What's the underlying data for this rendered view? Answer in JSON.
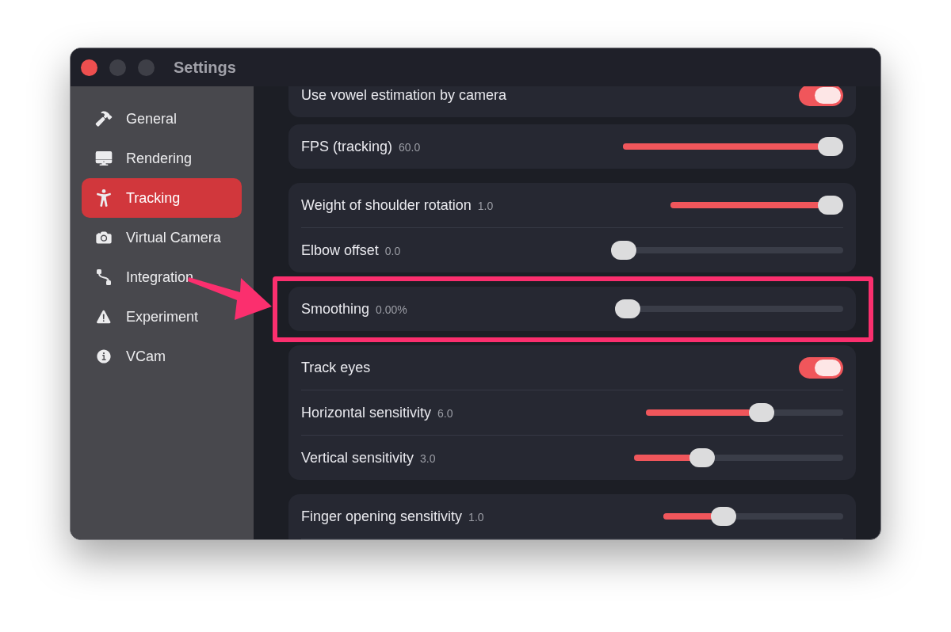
{
  "window": {
    "title": "Settings"
  },
  "sidebar": {
    "items": [
      {
        "label": "General",
        "selected": false
      },
      {
        "label": "Rendering",
        "selected": false
      },
      {
        "label": "Tracking",
        "selected": true
      },
      {
        "label": "Virtual Camera",
        "selected": false
      },
      {
        "label": "Integration",
        "selected": false
      },
      {
        "label": "Experiment",
        "selected": false
      },
      {
        "label": "VCam",
        "selected": false
      }
    ]
  },
  "settings": {
    "groups": [
      {
        "highlighted": false,
        "rows": [
          {
            "kind": "toggle",
            "label": "Use vowel estimation by camera",
            "on": true
          }
        ]
      },
      {
        "highlighted": false,
        "rows": [
          {
            "kind": "slider",
            "label": "FPS (tracking)",
            "reading": "60.0",
            "level": 1
          }
        ]
      },
      {
        "highlighted": false,
        "rows": [
          {
            "kind": "slider",
            "label": "Weight of shoulder rotation",
            "reading": "1.0",
            "level": 1
          },
          {
            "kind": "slider",
            "label": "Elbow offset",
            "reading": "0.0",
            "level": 0
          }
        ]
      },
      {
        "highlighted": true,
        "rows": [
          {
            "kind": "slider",
            "label": "Smoothing",
            "reading": "0.00%",
            "level": 0
          }
        ]
      },
      {
        "highlighted": false,
        "rows": [
          {
            "kind": "toggle",
            "label": "Track eyes",
            "on": true
          },
          {
            "kind": "slider",
            "label": "Horizontal sensitivity",
            "reading": "6.0",
            "level": 0.6
          },
          {
            "kind": "slider",
            "label": "Vertical sensitivity",
            "reading": "3.0",
            "level": 0.3
          }
        ]
      },
      {
        "highlighted": false,
        "rows": [
          {
            "kind": "slider",
            "label": "Finger opening sensitivity",
            "reading": "1.0",
            "level": 0.31
          }
        ]
      }
    ]
  }
}
